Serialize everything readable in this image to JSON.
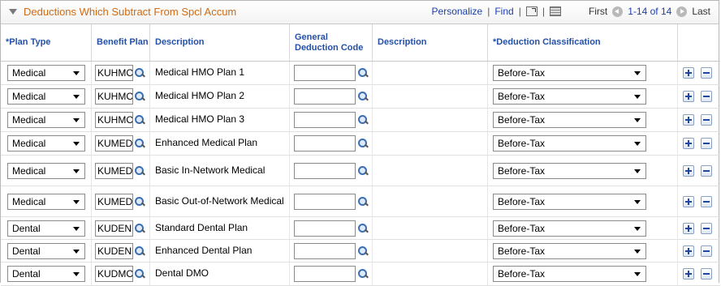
{
  "titlebar": {
    "title": "Deductions Which Subtract From Spcl Accum",
    "personalize": "Personalize",
    "find": "Find",
    "first": "First",
    "range": "1-14 of 14",
    "last": "Last"
  },
  "columns": {
    "plan_type": "*Plan Type",
    "benefit_plan": "Benefit Plan",
    "description": "Description",
    "general_deduction_code": "General Deduction Code",
    "description2": "Description",
    "deduction_classification": "*Deduction Classification"
  },
  "rows": [
    {
      "plan_type": "Medical",
      "benefit_plan": "KUHMO",
      "description": "Medical HMO Plan 1",
      "deduction_code": "",
      "classification": "Before-Tax"
    },
    {
      "plan_type": "Medical",
      "benefit_plan": "KUHMO",
      "description": "Medical HMO Plan 2",
      "deduction_code": "",
      "classification": "Before-Tax"
    },
    {
      "plan_type": "Medical",
      "benefit_plan": "KUHMO",
      "description": "Medical HMO Plan 3",
      "deduction_code": "",
      "classification": "Before-Tax"
    },
    {
      "plan_type": "Medical",
      "benefit_plan": "KUMED",
      "description": "Enhanced Medical Plan",
      "deduction_code": "",
      "classification": "Before-Tax"
    },
    {
      "plan_type": "Medical",
      "benefit_plan": "KUMED",
      "description": "Basic In-Network Medical",
      "deduction_code": "",
      "classification": "Before-Tax"
    },
    {
      "plan_type": "Medical",
      "benefit_plan": "KUMED",
      "description": "Basic Out-of-Network Medical",
      "deduction_code": "",
      "classification": "Before-Tax"
    },
    {
      "plan_type": "Dental",
      "benefit_plan": "KUDEN",
      "description": "Standard Dental Plan",
      "deduction_code": "",
      "classification": "Before-Tax"
    },
    {
      "plan_type": "Dental",
      "benefit_plan": "KUDEN",
      "description": "Enhanced Dental Plan",
      "deduction_code": "",
      "classification": "Before-Tax"
    },
    {
      "plan_type": "Dental",
      "benefit_plan": "KUDMO",
      "description": "Dental DMO",
      "deduction_code": "",
      "classification": "Before-Tax"
    }
  ]
}
